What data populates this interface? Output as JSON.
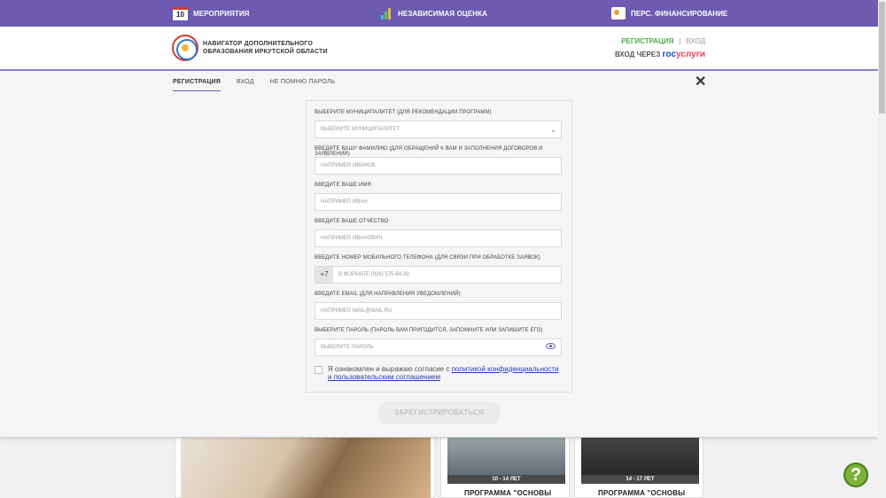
{
  "topbar": {
    "calendar_day": "10",
    "events": "МЕРОПРИЯТИЯ",
    "assessment": "НЕЗАВИСИМАЯ ОЦЕНКА",
    "financing": "ПЕРС. ФИНАНСИРОВАНИЕ"
  },
  "header": {
    "brand_line1": "НАВИГАТОР ДОПОЛНИТЕЛЬНОГО",
    "brand_line2": "ОБРАЗОВАНИЯ ИРКУТСКОЙ ОБЛАСТИ",
    "register": "РЕГИСТРАЦИЯ",
    "separator": "|",
    "login": "ВХОД",
    "login_via": "ВХОД ЧЕРЕЗ",
    "gos_part1": "гос",
    "gos_part2": "услуги"
  },
  "tabs": [
    "РЕГИСТРАЦИЯ",
    "ВХОД",
    "НЕ ПОМНЮ ПАРОЛЬ"
  ],
  "form": {
    "municipality_label": "ВЫБЕРИТЕ МУНИЦИПАЛИТЕТ (ДЛЯ РЕКОМЕНДАЦИИ ПРОГРАММ)",
    "municipality_placeholder": "ВЫБЕРИТЕ МУНИЦИПАЛИТЕТ",
    "surname_label": "ВВЕДИТЕ ВАШУ ФАМИЛИЮ (ДЛЯ ОБРАЩЕНИЙ К ВАМ И ЗАПОЛНЕНИЯ ДОГОВОРОВ И ЗАЯВЛЕНИЙ)",
    "surname_placeholder": "НАПРИМЕР, ИВАНОВ",
    "name_label": "ВВЕДИТЕ ВАШЕ ИМЯ",
    "name_placeholder": "НАПРИМЕР, ИВАН",
    "patronymic_label": "ВВЕДИТЕ ВАШЕ ОТЧЕСТВО",
    "patronymic_placeholder": "НАПРИМЕР, ИВАНОВИЧ",
    "phone_label": "ВВЕДИТЕ НОМЕР МОБИЛЬНОГО ТЕЛЕФОНА (ДЛЯ СВЯЗИ ПРИ ОБРАБОТКЕ ЗАЯВОК)",
    "phone_prefix": "+7",
    "phone_placeholder": "В ФОРМАТЕ (926) 575-84-39",
    "email_label": "ВВЕДИТЕ EMAIL (ДЛЯ НАПРАВЛЕНИЯ УВЕДОМЛЕНИЙ)",
    "email_placeholder": "НАПРИМЕР, MAIL@MAIL.RU",
    "password_label": "ВЫБЕРИТЕ ПАРОЛЬ (ПАРОЛЬ ВАМ ПРИГОДИТСЯ, ЗАПОМНИТЕ ИЛИ ЗАПИШИТЕ ЕГО)",
    "password_placeholder": "ВЫБЕРИТЕ ПАРОЛЬ",
    "agree_text": "Я ознакомлен и выражаю согласие с ",
    "agree_link": "политикой конфиденциальности и пользовательским соглашением",
    "submit": "ЗАРЕГИСТРИРОВАТЬСЯ"
  },
  "cards": [
    {
      "badge": "10 - 14 ЛЕТ",
      "title": "ПРОГРАММА \"ОСНОВЫ"
    },
    {
      "badge": "14 - 17 ЛЕТ",
      "title": "ПРОГРАММА \"ОСНОВЫ"
    }
  ],
  "help": "?",
  "colors": {
    "accent": "#6c5bb0",
    "register": "#4fae4a",
    "link": "#2a3bb0",
    "help": "#7cb23a"
  }
}
